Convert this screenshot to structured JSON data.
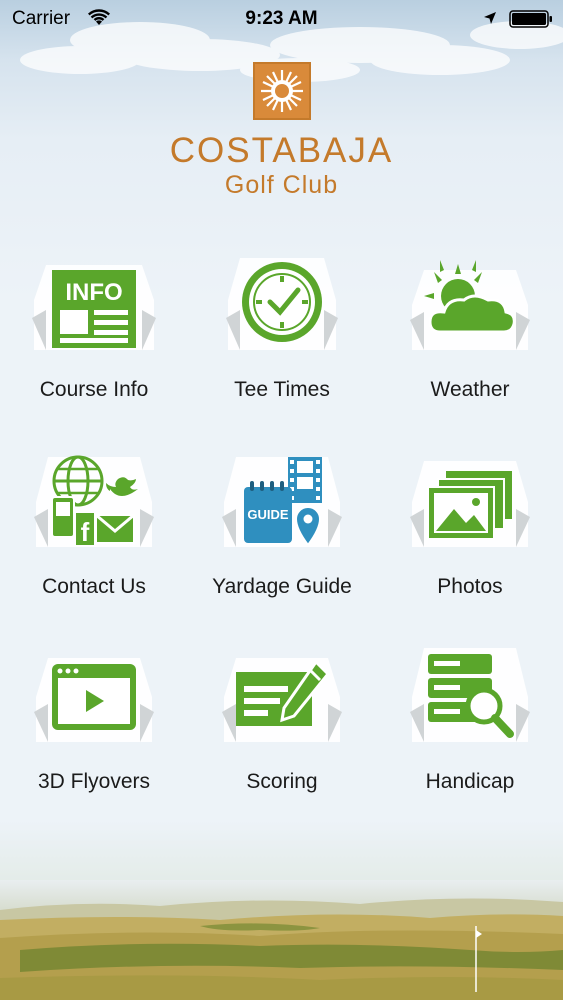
{
  "status_bar": {
    "carrier": "Carrier",
    "time": "9:23 AM"
  },
  "brand": {
    "name": "COSTABAJA",
    "subtitle": "Golf Club",
    "color": "#c47a2b",
    "icon_green": "#5aa62b"
  },
  "menu": [
    {
      "label": "Course Info",
      "icon": "info-document-icon"
    },
    {
      "label": "Tee Times",
      "icon": "clock-icon"
    },
    {
      "label": "Weather",
      "icon": "sun-cloud-icon"
    },
    {
      "label": "Contact Us",
      "icon": "contact-social-icon"
    },
    {
      "label": "Yardage Guide",
      "icon": "guide-map-pin-icon"
    },
    {
      "label": "Photos",
      "icon": "photo-stack-icon"
    },
    {
      "label": "3D Flyovers",
      "icon": "video-play-icon"
    },
    {
      "label": "Scoring",
      "icon": "scorecard-pencil-icon"
    },
    {
      "label": "Handicap",
      "icon": "database-search-icon"
    }
  ],
  "icon_text": {
    "info": "INFO",
    "guide": "GUIDE"
  }
}
